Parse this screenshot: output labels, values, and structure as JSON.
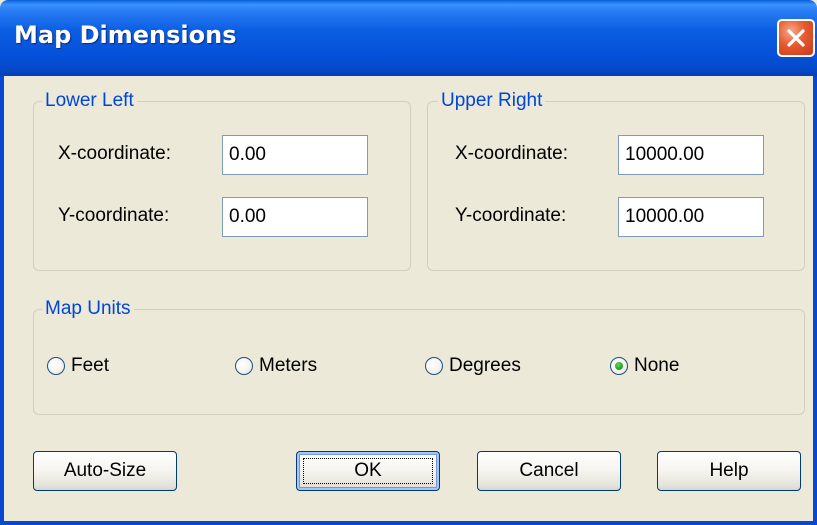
{
  "window": {
    "title": "Map Dimensions"
  },
  "lower_left": {
    "legend": "Lower Left",
    "x_label": "X-coordinate:",
    "x_value": "0.00",
    "y_label": "Y-coordinate:",
    "y_value": "0.00"
  },
  "upper_right": {
    "legend": "Upper Right",
    "x_label": "X-coordinate:",
    "x_value": "10000.00",
    "y_label": "Y-coordinate:",
    "y_value": "10000.00"
  },
  "map_units": {
    "legend": "Map Units",
    "options": [
      "Feet",
      "Meters",
      "Degrees",
      "None"
    ],
    "selected": "None"
  },
  "buttons": {
    "auto_size": "Auto-Size",
    "ok": "OK",
    "cancel": "Cancel",
    "help": "Help"
  },
  "colors": {
    "title_bar": "#0550d8",
    "group_legend": "#0046d5",
    "close_button": "#e55a2f",
    "dialog_background": "#ece9d8"
  }
}
